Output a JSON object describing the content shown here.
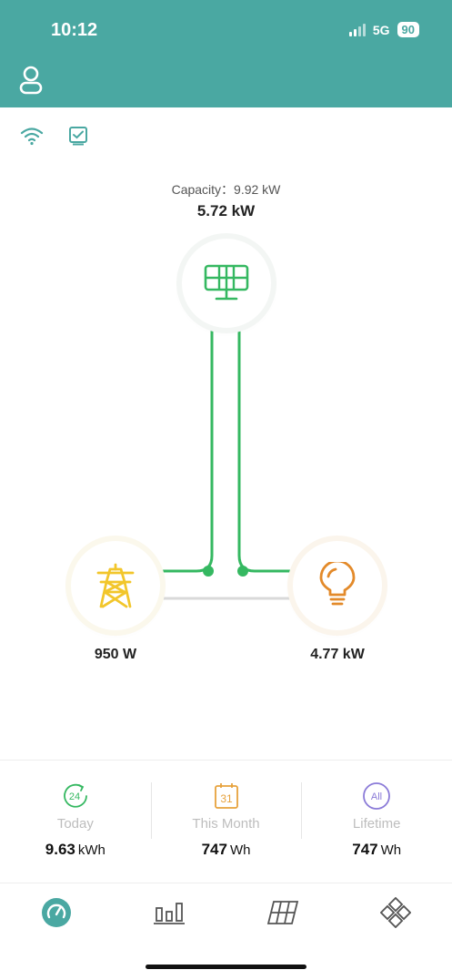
{
  "status_bar": {
    "time": "10:12",
    "network": "5G",
    "battery": "90"
  },
  "energy_flow": {
    "capacity_label": "Capacity：9.92 kW",
    "pv_power": "5.72 kW",
    "grid_power": "950 W",
    "load_power": "4.77 kW"
  },
  "summary": {
    "items": [
      {
        "icon_text": "24",
        "label": "Today",
        "value": "9.63",
        "unit": "kWh"
      },
      {
        "icon_text": "31",
        "label": "This Month",
        "value": "747",
        "unit": "Wh"
      },
      {
        "icon_text": "All",
        "label": "Lifetime",
        "value": "747",
        "unit": "Wh"
      }
    ]
  },
  "icons": {
    "user": "user-icon",
    "wifi": "wifi-icon",
    "report": "report-icon",
    "solar": "solar-panel-icon",
    "grid": "power-tower-icon",
    "load": "light-bulb-icon",
    "tabs": [
      "dashboard-icon",
      "bar-chart-icon",
      "solar-grid-icon",
      "devices-icon"
    ]
  },
  "colors": {
    "accent": "#4aa8a2",
    "flow": "#35b861",
    "grid": "#f2c62b",
    "load": "#e38a2a",
    "today": "#35b861",
    "month": "#e7a23d",
    "lifetime": "#8b7bd8"
  }
}
